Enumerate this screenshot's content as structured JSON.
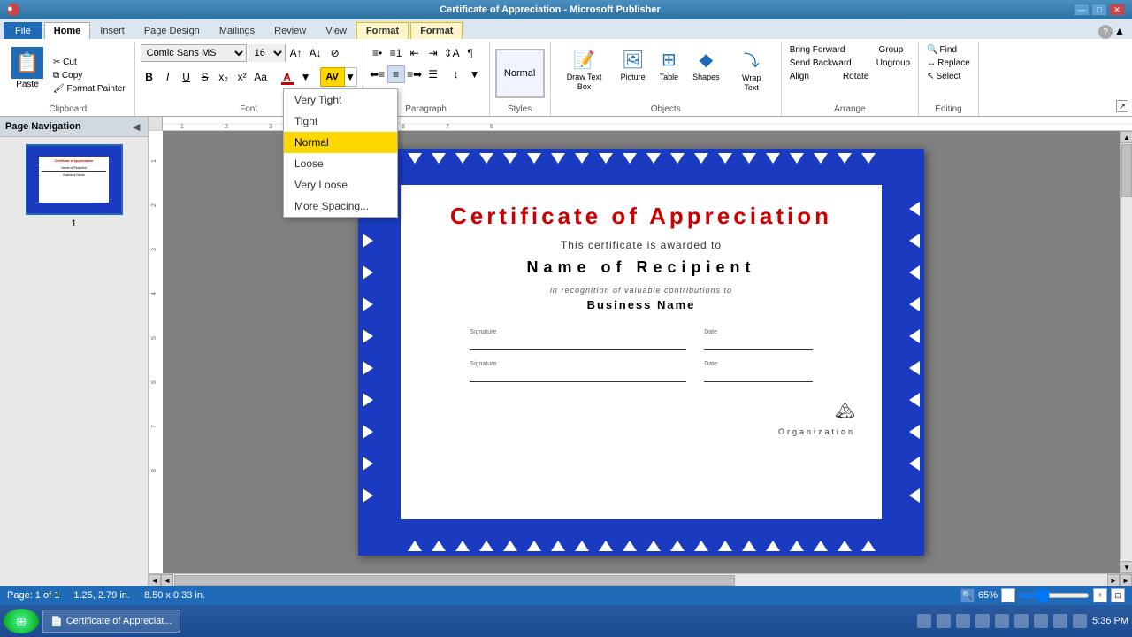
{
  "titlebar": {
    "text": "Certificate of Appreciation - Microsoft Publisher",
    "minimize": "—",
    "maximize": "□",
    "close": "✕"
  },
  "tabs": [
    {
      "id": "file",
      "label": "File"
    },
    {
      "id": "home",
      "label": "Home"
    },
    {
      "id": "insert",
      "label": "Insert"
    },
    {
      "id": "page_design",
      "label": "Page Design"
    },
    {
      "id": "mailings",
      "label": "Mailings"
    },
    {
      "id": "review",
      "label": "Review"
    },
    {
      "id": "view",
      "label": "View"
    },
    {
      "id": "format1",
      "label": "Format"
    },
    {
      "id": "format2",
      "label": "Format"
    }
  ],
  "ribbon": {
    "clipboard": {
      "label": "Clipboard",
      "paste": "Paste",
      "cut": "Cut",
      "copy": "Copy",
      "format_painter": "Format Painter"
    },
    "font": {
      "label": "Font",
      "font_name": "Comic Sans MS",
      "font_size": "16",
      "bold": "B",
      "italic": "I",
      "underline": "U",
      "strikethrough": "S",
      "superscript": "x²",
      "subscript": "x₂",
      "change_case": "Aa",
      "font_color": "A",
      "char_spacing": "AV"
    },
    "paragraph": {
      "label": "Paragraph",
      "align_left": "≡",
      "align_center": "≡",
      "align_right": "≡",
      "justify": "≡",
      "bullets": "≡",
      "numbering": "≡",
      "indent_less": "←",
      "indent_more": "→",
      "line_spacing": "↕",
      "show_para": "¶"
    },
    "styles": {
      "label": "Styles",
      "name": "Normal"
    },
    "objects": {
      "label": "Objects",
      "draw_text_box": "Draw Text Box",
      "picture": "Picture",
      "table": "Table",
      "shapes": "Shapes",
      "wrap_text": "Wrap Text"
    },
    "arrange": {
      "label": "Arrange",
      "bring_forward": "Bring Forward",
      "send_backward": "Send Backward",
      "align": "Align",
      "group": "Group",
      "ungroup": "Ungroup",
      "rotate": "Rotate"
    },
    "editing": {
      "label": "Editing",
      "find": "Find",
      "replace": "Replace",
      "select": "Select"
    }
  },
  "char_spacing_menu": {
    "items": [
      {
        "id": "very_tight",
        "label": "Very Tight",
        "highlighted": false
      },
      {
        "id": "tight",
        "label": "Tight",
        "highlighted": false
      },
      {
        "id": "normal",
        "label": "Normal",
        "highlighted": true
      },
      {
        "id": "loose",
        "label": "Loose",
        "highlighted": false
      },
      {
        "id": "very_loose",
        "label": "Very Loose",
        "highlighted": false
      },
      {
        "id": "more_spacing",
        "label": "More Spacing...",
        "highlighted": false
      }
    ]
  },
  "navigation": {
    "header": "Page Navigation",
    "page_number": "1"
  },
  "certificate": {
    "title": "Certificate of Appreciation",
    "subtitle": "This certificate is awarded to",
    "recipient": "Name of Recipient",
    "recognition": "in recognition of valuable contributions to",
    "business": "Business Name",
    "signature1": "Signature",
    "date1": "Date",
    "signature2": "Signature",
    "date2": "Date",
    "org": "Organization"
  },
  "statusbar": {
    "page": "Page: 1 of 1",
    "position": "1.25, 2.79 in.",
    "size": "8.50 x 0.33 in.",
    "zoom": "65%"
  },
  "taskbar": {
    "time": "5:36 PM"
  }
}
